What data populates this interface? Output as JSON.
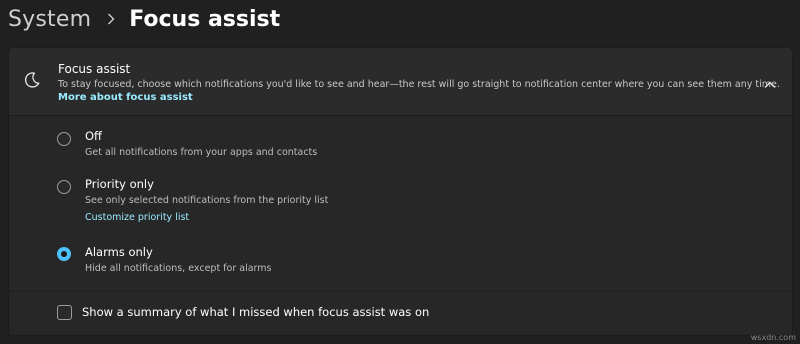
{
  "breadcrumb": {
    "parent": "System",
    "current": "Focus assist"
  },
  "focus_assist": {
    "icon": "moon-icon",
    "title": "Focus assist",
    "description": "To stay focused, choose which notifications you'd like to see and hear—the rest will go straight to notification center where you can see them any time.",
    "link": "More about focus assist",
    "expanded": true
  },
  "options": [
    {
      "label": "Off",
      "description": "Get all notifications from your apps and contacts",
      "selected": false
    },
    {
      "label": "Priority only",
      "description": "See only selected notifications from the priority list",
      "link": "Customize priority list",
      "selected": false
    },
    {
      "label": "Alarms only",
      "description": "Hide all notifications, except for alarms",
      "selected": true
    }
  ],
  "summary": {
    "label": "Show a summary of what I missed when focus assist was on",
    "checked": false
  },
  "watermark": "wsxdn.com",
  "colors": {
    "accent": "#4cc2ff",
    "link": "#99ebff",
    "background": "#202020",
    "card": "#2b2b2b"
  }
}
